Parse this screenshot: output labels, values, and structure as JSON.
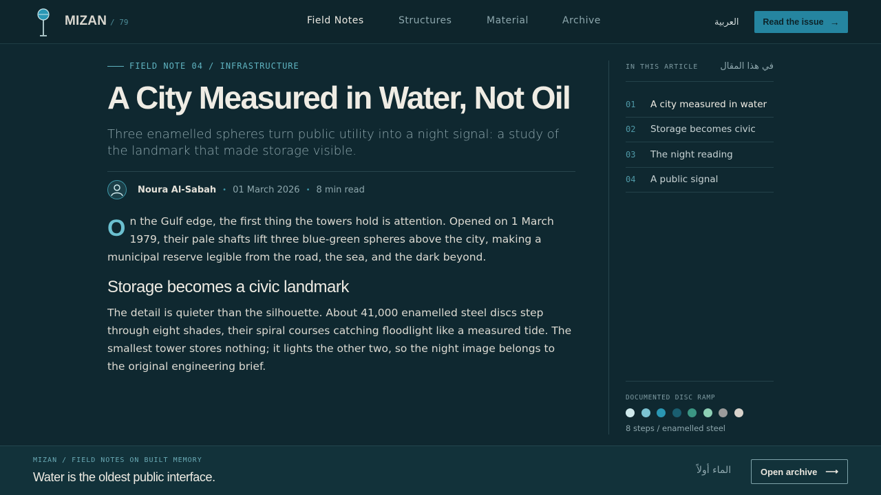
{
  "brand": {
    "name": "MIZAN",
    "issue": "/ 79"
  },
  "nav": {
    "items": [
      {
        "label": "Field Notes",
        "active": true
      },
      {
        "label": "Structures",
        "active": false
      },
      {
        "label": "Material",
        "active": false
      },
      {
        "label": "Archive",
        "active": false
      }
    ],
    "language": "العربية",
    "cta_label": "Read the issue",
    "cta_arrow": "→"
  },
  "article": {
    "kicker": "FIELD NOTE 04 / INFRASTRUCTURE",
    "title": "A City Measured in Water, Not Oil",
    "dek": "Three enamelled spheres turn public utility into a night signal: a study of the landmark that made storage visible.",
    "author": "Noura Al-Sabah",
    "date": "01 March 2026",
    "read_time": "8 min read",
    "separator": "•",
    "dropcap": "O",
    "para1": "n the Gulf edge, the first thing the towers hold is attention. Opened on 1 March 1979, their pale shafts lift three blue-green spheres above the city, making a municipal reserve legible from the road, the sea, and the dark beyond.",
    "section_heading": "Storage becomes a civic landmark",
    "para2": "The detail is quieter than the silhouette. About 41,000 enamelled steel discs step through eight shades, their spiral courses catching floodlight like a measured tide. The smallest tower stores nothing; it lights the other two, so the night image belongs to the original engineering brief."
  },
  "toc": {
    "label": "IN THIS ARTICLE",
    "label_ar": "في هذا المقال",
    "items": [
      {
        "num": "01",
        "text": "A city measured in water",
        "active": true
      },
      {
        "num": "02",
        "text": "Storage becomes civic",
        "active": false
      },
      {
        "num": "03",
        "text": "The night reading",
        "active": false
      },
      {
        "num": "04",
        "text": "A public signal",
        "active": false
      }
    ]
  },
  "ramp": {
    "label": "DOCUMENTED DISC RAMP",
    "caption": "8 steps / enamelled steel",
    "colors": [
      "#cfe9ec",
      "#7cc3d2",
      "#2a97b4",
      "#1a5e70",
      "#3b9683",
      "#8ed0b6",
      "#9b9b9b",
      "#d8d2cb"
    ]
  },
  "footer": {
    "kicker": "MIZAN / FIELD NOTES ON BUILT MEMORY",
    "tagline": "Water is the oldest public interface.",
    "arabic": "الماء أولاً",
    "button_label": "Open archive",
    "button_arrow": "⟶"
  },
  "icons": {
    "logo": "water-tower-icon",
    "avatar": "user-avatar-icon"
  },
  "colors": {
    "background": "#0f2830",
    "accent": "#2585a0",
    "accent_text": "#5fb3c0"
  }
}
